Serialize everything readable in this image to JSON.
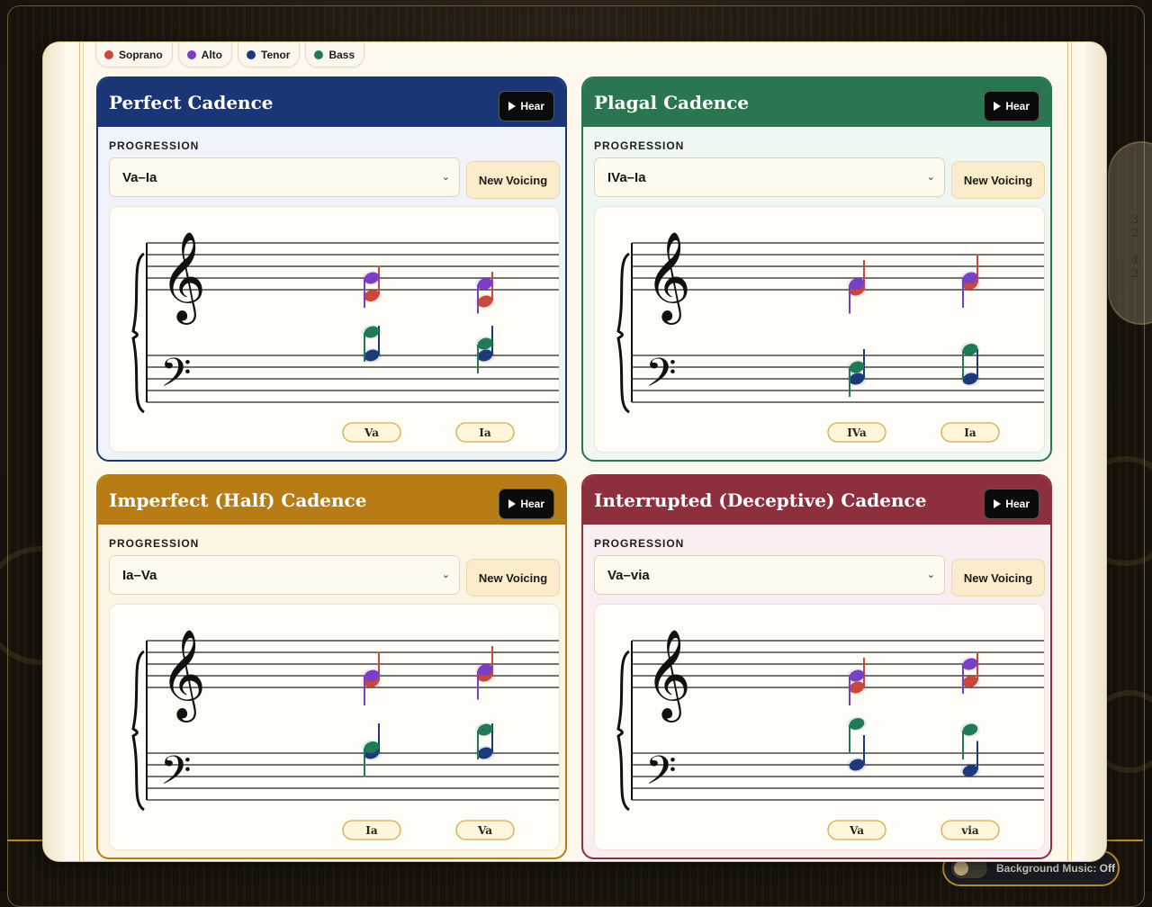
{
  "legend": [
    {
      "label": "Soprano",
      "color": "#c8483a"
    },
    {
      "label": "Alto",
      "color": "#7b3fc3"
    },
    {
      "label": "Tenor",
      "color": "#1c3a7a"
    },
    {
      "label": "Bass",
      "color": "#1f7a55"
    }
  ],
  "cards": [
    {
      "title": "Perfect Cadence",
      "color": "#1b3677",
      "panel_bg": "#f1f3fb",
      "hear_label": "Hear",
      "progression_label": "PROGRESSION",
      "progression_value": "Va–Ia",
      "voicing_label": "New Voicing",
      "chords": [
        {
          "label": "Va",
          "soprano": 11,
          "alto": 8,
          "tenor": 13,
          "bass": 9
        },
        {
          "label": "Ia",
          "soprano": 12,
          "alto": 9,
          "tenor": 13,
          "bass": 11
        }
      ]
    },
    {
      "title": "Plagal Cadence",
      "color": "#2a7650",
      "panel_bg": "#eef7f1",
      "hear_label": "Hear",
      "progression_label": "PROGRESSION",
      "progression_value": "IVa–Ia",
      "voicing_label": "New Voicing",
      "chords": [
        {
          "label": "IVa",
          "soprano": 10,
          "alto": 9,
          "tenor": 17,
          "bass": 15
        },
        {
          "label": "Ia",
          "soprano": 9,
          "alto": 8,
          "tenor": 17,
          "bass": 12
        }
      ]
    },
    {
      "title": "Imperfect (Half) Cadence",
      "color": "#b77c16",
      "panel_bg": "#fdf5e4",
      "hear_label": "Hear",
      "progression_label": "PROGRESSION",
      "progression_value": "Ia–Va",
      "voicing_label": "New Voicing",
      "chords": [
        {
          "label": "Ia",
          "soprano": 9,
          "alto": 8,
          "tenor": 13,
          "bass": 12
        },
        {
          "label": "Va",
          "soprano": 8,
          "alto": 7,
          "tenor": 13,
          "bass": 9
        }
      ]
    },
    {
      "title": "Interrupted (Deceptive) Cadence",
      "color": "#8e2f3e",
      "panel_bg": "#faeef0",
      "hear_label": "Hear",
      "progression_label": "PROGRESSION",
      "progression_value": "Va–via",
      "voicing_label": "New Voicing",
      "chords": [
        {
          "label": "Va",
          "soprano": 10,
          "alto": 8,
          "tenor": 15,
          "bass": 8
        },
        {
          "label": "via",
          "soprano": 9,
          "alto": 6,
          "tenor": 16,
          "bass": 9
        }
      ]
    }
  ],
  "music_toggle": {
    "label": "Background Music: Off",
    "state": "off"
  }
}
